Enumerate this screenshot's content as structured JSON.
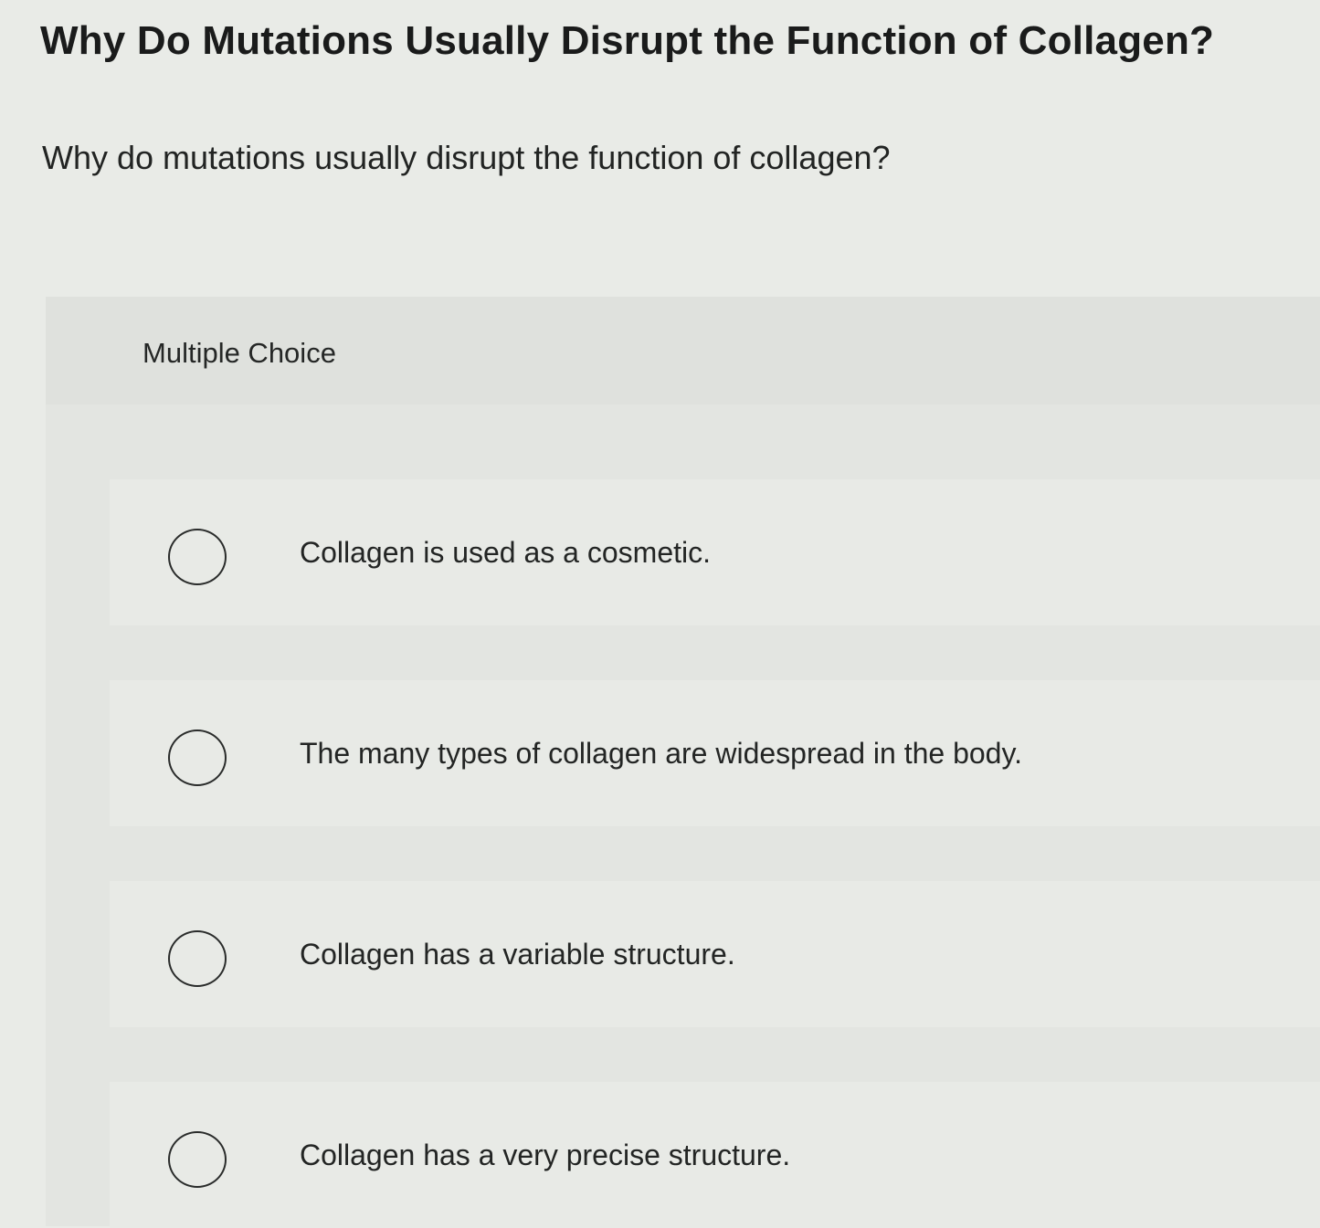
{
  "page": {
    "title": "Why Do Mutations Usually Disrupt the Function of Collagen?",
    "question": "Why do mutations usually disrupt the function of collagen?"
  },
  "multiple_choice": {
    "label": "Multiple Choice",
    "options": [
      {
        "label": "Collagen is used as a cosmetic.",
        "selected": false
      },
      {
        "label": "The many types of collagen are widespread in the body.",
        "selected": false
      },
      {
        "label": "Collagen has a variable structure.",
        "selected": false
      },
      {
        "label": "Collagen has a very precise structure.",
        "selected": false
      }
    ]
  },
  "colors": {
    "background": "#e9ebe7",
    "panel": "#e1e3df",
    "text": "#1e1f1f"
  }
}
